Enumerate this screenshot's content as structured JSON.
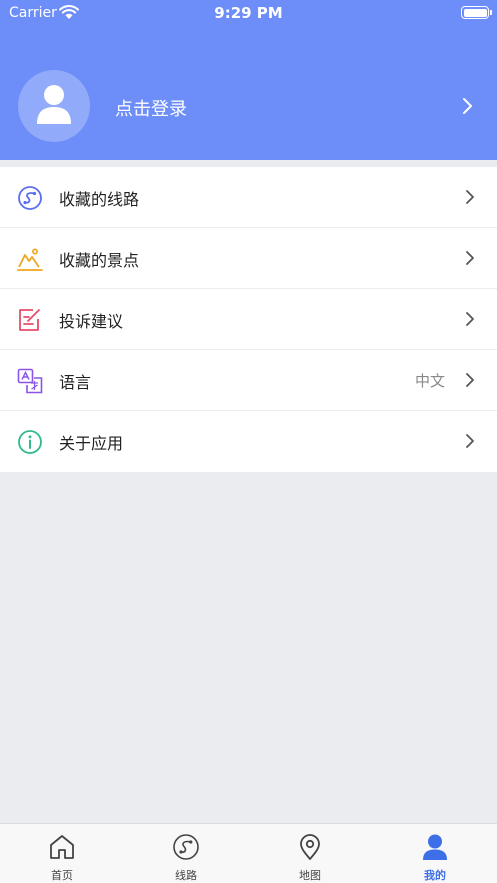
{
  "status_bar": {
    "carrier": "Carrier",
    "time": "9:29 PM"
  },
  "profile": {
    "login_label": "点击登录",
    "icon": "avatar-icon"
  },
  "menu": {
    "items": [
      {
        "label": "收藏的线路",
        "value": "",
        "icon": "route-icon",
        "icon_color": "#5b6ef0"
      },
      {
        "label": "收藏的景点",
        "value": "",
        "icon": "scenic-spot-icon",
        "icon_color": "#f0a51e"
      },
      {
        "label": "投诉建议",
        "value": "",
        "icon": "feedback-icon",
        "icon_color": "#e84d6a"
      },
      {
        "label": "语言",
        "value": "中文",
        "icon": "language-icon",
        "icon_color": "#8a55e6"
      },
      {
        "label": "关于应用",
        "value": "",
        "icon": "info-icon",
        "icon_color": "#2fb98a"
      }
    ]
  },
  "tabbar": {
    "tabs": [
      {
        "label": "首页",
        "icon": "home-icon",
        "active": false
      },
      {
        "label": "线路",
        "icon": "route-icon",
        "active": false
      },
      {
        "label": "地图",
        "icon": "map-pin-icon",
        "active": false
      },
      {
        "label": "我的",
        "icon": "user-icon",
        "active": true
      }
    ]
  },
  "colors": {
    "header_bg": "#6d8ef9",
    "active_tab": "#3d6fe8",
    "page_bg": "#ebecf0"
  }
}
